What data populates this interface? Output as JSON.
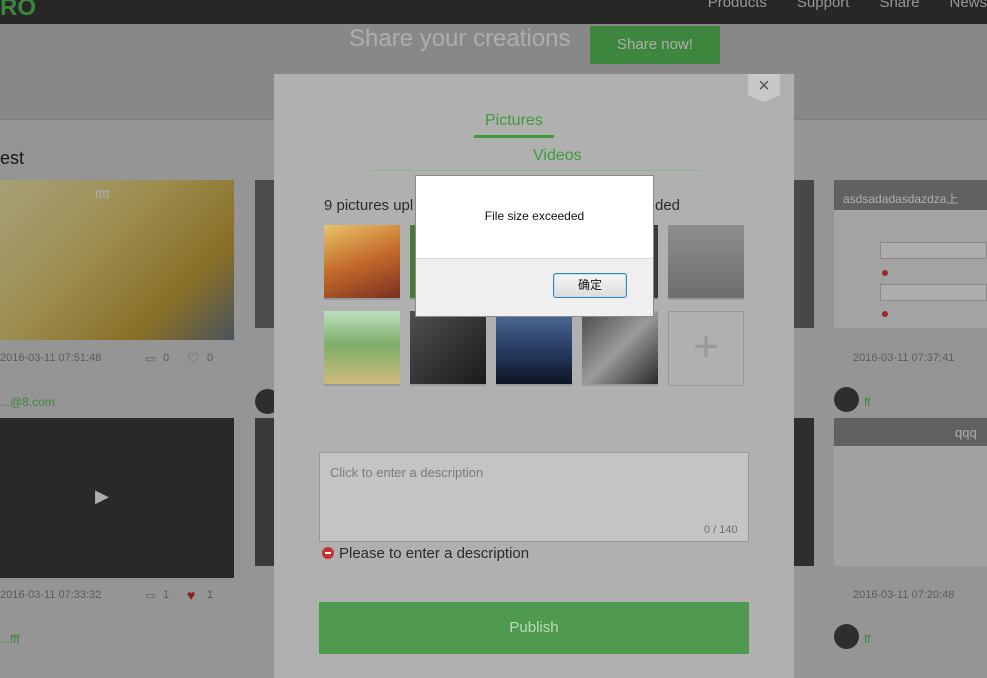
{
  "header": {
    "logo_text": "RO",
    "nav": [
      "Products",
      "Support",
      "Share",
      "News"
    ]
  },
  "hero": {
    "title": "Share your creations",
    "button_label": "Share now!"
  },
  "feed": {
    "section_title": "est",
    "card1_title": "tttt",
    "card1_time": "2016-03-11 07:51:48",
    "card1_comments": "0",
    "card1_likes": "0",
    "card1_user": "...@8.com",
    "card2_time": "2016-03-11 07:33:32",
    "card2_comments": "1",
    "card2_likes": "1",
    "card2_user": "...fff",
    "right_card1_title": "asdsadadasdazdza上",
    "right_card1_time": "2016-03-11 07:37:41",
    "right_card2_title": "qqq",
    "right_card2_time": "2016-03-11 07:20:48",
    "right_user1": "ff",
    "right_user2": "ff"
  },
  "upload_modal": {
    "close_icon": "×",
    "tab_pictures": "Pictures",
    "tab_videos": "Videos",
    "uploaded_count_prefix": "9 pictures upl",
    "uploaded_count_suffix": "ded",
    "add_icon": "+",
    "description_placeholder": "Click to enter a description",
    "description_counter": "0 / 140",
    "error_message": "Please to enter a description",
    "publish_label": "Publish"
  },
  "alert_dialog": {
    "message": "File size exceeded",
    "ok_label": "确定"
  },
  "colors": {
    "accent_green": "#5cc45c",
    "error_red": "#c43232"
  }
}
